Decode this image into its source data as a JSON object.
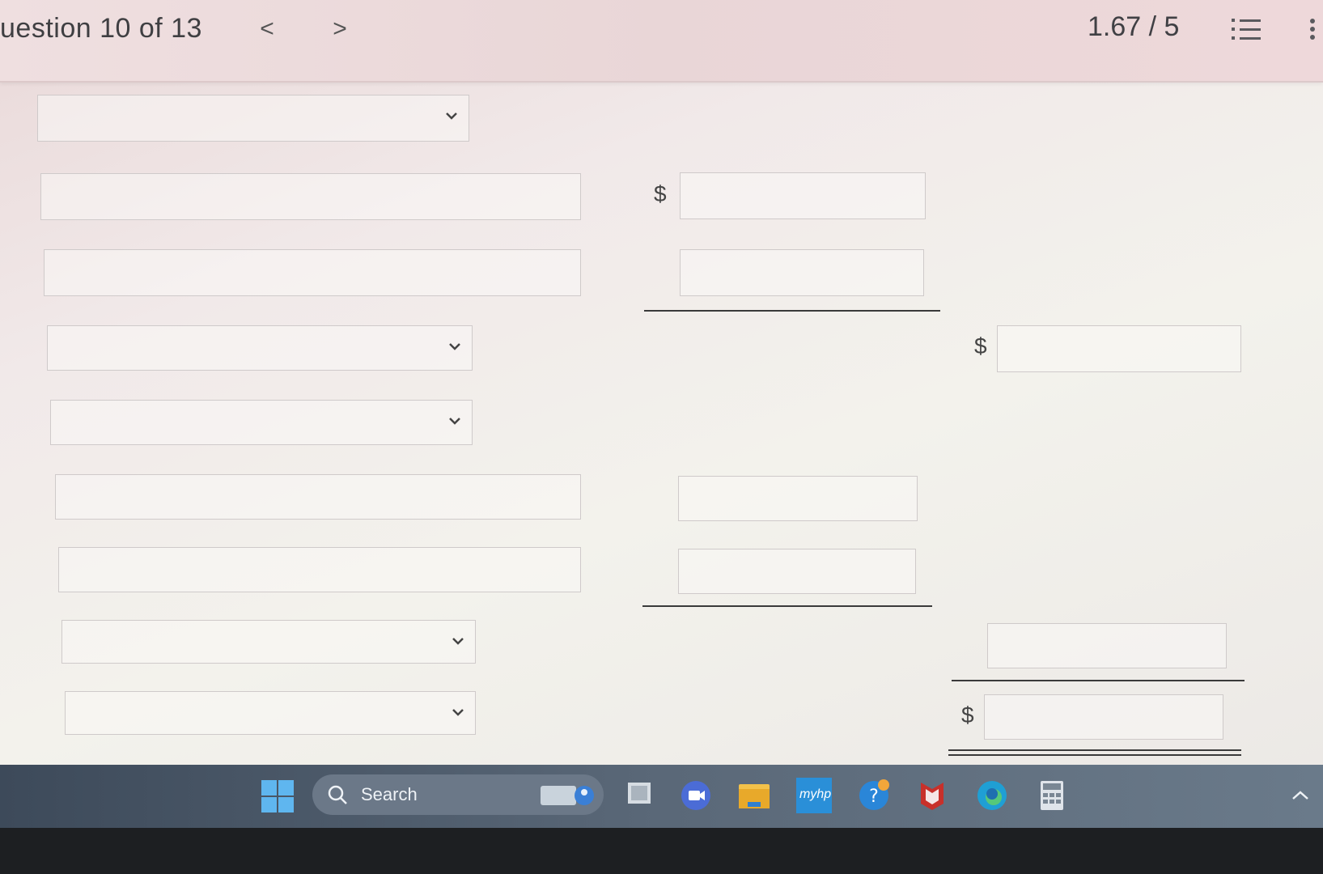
{
  "header": {
    "question_label": "uestion 10 of 13",
    "prev_label": "<",
    "next_label": ">",
    "score": "1.67 / 5"
  },
  "form": {
    "currency_symbol": "$"
  },
  "taskbar": {
    "search_label": "Search",
    "icons": [
      "windows-start-icon",
      "search-icon",
      "widgets-icon",
      "file-explorer-icon",
      "camera-icon",
      "folder-icon",
      "myhp-icon",
      "help-icon",
      "mcafee-icon",
      "edge-icon",
      "calculator-icon",
      "chevron-up-icon"
    ],
    "myhp_text": "myhp"
  }
}
